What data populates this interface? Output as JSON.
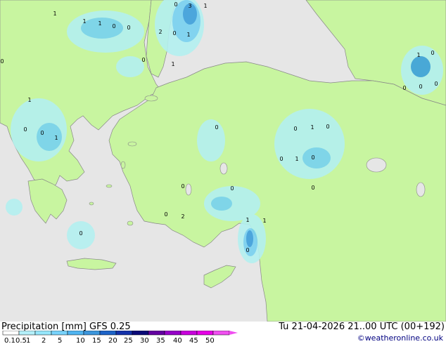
{
  "header": {
    "left_title": "Precipitation [mm]  GFS 0.25",
    "right_title": "Tu 21-04-2026 21..00 UTC (00+192)",
    "credit": "©weatheronline.co.uk"
  },
  "colors": {
    "sea": "#e6e6e6",
    "land": "#c8f5a0",
    "coast": "#888888",
    "precip_light": "#b4f0f0",
    "precip_mid": "#78d2f0",
    "precip_heavy": "#3ca0dc"
  },
  "scale": {
    "labels": [
      "0.1",
      "0.5",
      "1",
      "2",
      "5",
      "10",
      "15",
      "20",
      "25",
      "30",
      "35",
      "40",
      "45",
      "50"
    ],
    "colors": [
      "#ffffff",
      "#b4f0fa",
      "#96e6fa",
      "#78d2fa",
      "#50b4f0",
      "#3c96dc",
      "#1e64c8",
      "#1432aa",
      "#0a0a78",
      "#6400a0",
      "#9600c8",
      "#c800dc",
      "#e600e6",
      "#f050f0"
    ]
  },
  "map_labels": [
    {
      "text": "0"
    },
    {
      "text": "3"
    },
    {
      "text": "1"
    },
    {
      "text": "1"
    },
    {
      "text": "1"
    },
    {
      "text": "1"
    },
    {
      "text": "0"
    },
    {
      "text": "0"
    },
    {
      "text": "2"
    },
    {
      "text": "0"
    },
    {
      "text": "1"
    },
    {
      "text": "0"
    },
    {
      "text": "0"
    },
    {
      "text": "1"
    },
    {
      "text": "1"
    },
    {
      "text": "0"
    },
    {
      "text": "0"
    },
    {
      "text": "0"
    },
    {
      "text": "0"
    },
    {
      "text": "1"
    },
    {
      "text": "0"
    },
    {
      "text": "0"
    },
    {
      "text": "1"
    },
    {
      "text": "0"
    },
    {
      "text": "0"
    },
    {
      "text": "1"
    },
    {
      "text": "0"
    },
    {
      "text": "0"
    },
    {
      "text": "1"
    },
    {
      "text": "0"
    },
    {
      "text": "0"
    },
    {
      "text": "0"
    },
    {
      "text": "0"
    },
    {
      "text": "0"
    },
    {
      "text": "2"
    },
    {
      "text": "1"
    },
    {
      "text": "1"
    },
    {
      "text": "0"
    },
    {
      "text": "0"
    }
  ]
}
